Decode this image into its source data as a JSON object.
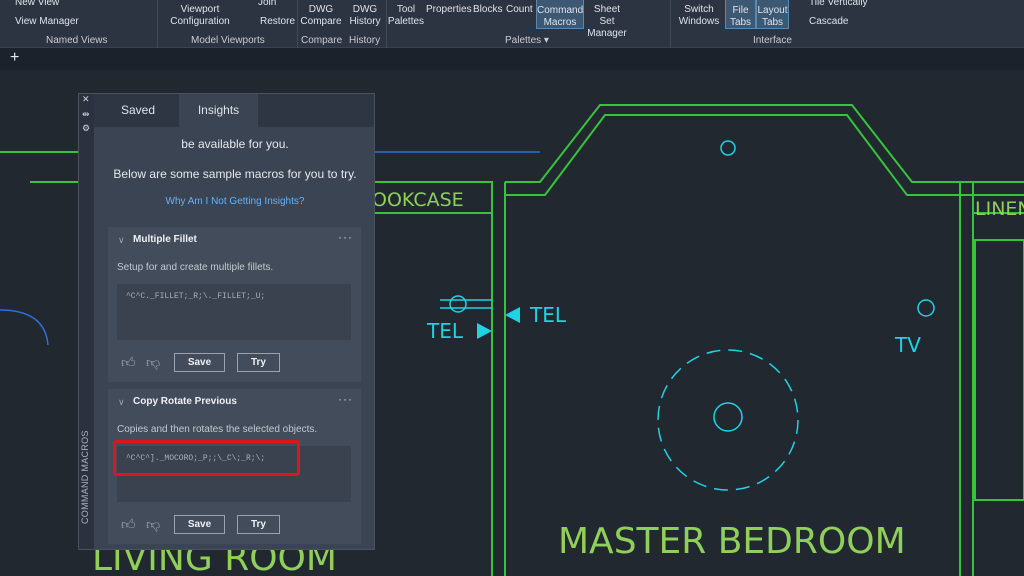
{
  "ribbon": {
    "named_views": {
      "new_view": "New View",
      "view_manager": "View Manager",
      "label": "Named Views"
    },
    "model_viewports": {
      "viewport_config": "Viewport Configuration",
      "join": "Join",
      "restore": "Restore",
      "label": "Model Viewports"
    },
    "compare": {
      "button": "DWG Compare",
      "label": "Compare"
    },
    "history": {
      "button": "DWG History",
      "label": "History"
    },
    "palettes": {
      "tool_palettes": "Tool Palettes",
      "properties": "Properties",
      "blocks": "Blocks",
      "count": "Count",
      "command_macros": "Command Macros",
      "sheet_set": "Sheet Set Manager",
      "label": "Palettes"
    },
    "interface": {
      "switch_windows": "Switch Windows",
      "file_tabs": "File Tabs",
      "layout_tabs": "Layout Tabs",
      "tile_vertically": "Tile Vertically",
      "cascade": "Cascade",
      "label": "Interface"
    }
  },
  "tabbar": {
    "add": "+"
  },
  "panel": {
    "side_title": "COMMAND MACROS",
    "tabs": [
      {
        "label": "Saved"
      },
      {
        "label": "Insights",
        "active": true
      }
    ],
    "intro_partial": "be available for you.",
    "intro": "Below are some sample macros for you to try.",
    "why_link": "Why Am I Not Getting Insights?",
    "cards": [
      {
        "title": "Multiple Fillet",
        "description": "Setup for and create multiple fillets.",
        "macro": "^C^C._FILLET;_R;\\._FILLET;_U;",
        "save": "Save",
        "try": "Try"
      },
      {
        "title": "Copy Rotate Previous",
        "description": "Copies and then rotates the selected objects.",
        "macro": "^C^C^]._MOCORO;_P;;\\_C\\;_R;\\;",
        "save": "Save",
        "try": "Try"
      }
    ]
  },
  "drawing": {
    "labels": {
      "bookcase": "OOKCASE",
      "tel_left": "TEL",
      "tel_right": "TEL",
      "tv": "TV",
      "linen": "LINEN",
      "master_bedroom": "MASTER BEDROOM",
      "living_room": "LIVING ROOM"
    },
    "colors": {
      "wall": "#36c43a",
      "cyan": "#1fd3e6",
      "blue": "#2e6fd8",
      "label": "#8fcf5a"
    }
  }
}
